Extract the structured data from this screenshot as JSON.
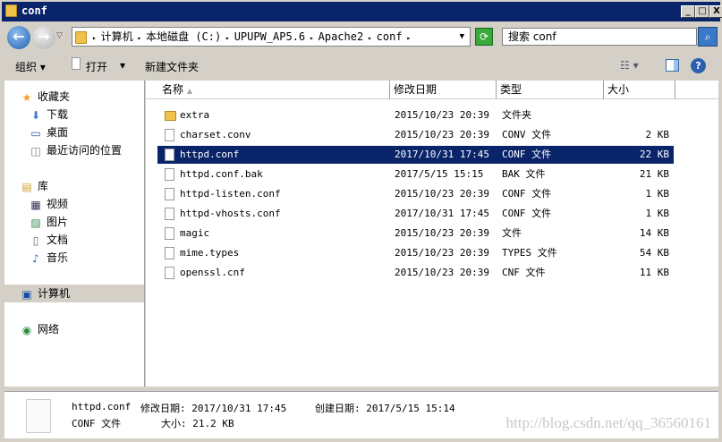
{
  "window": {
    "title": "conf",
    "buttons": [
      "_",
      "□",
      "X"
    ]
  },
  "address": {
    "path": [
      "计算机",
      "本地磁盘 (C:)",
      "UPUPW_AP5.6",
      "Apache2",
      "conf"
    ],
    "search_placeholder": "搜索 conf"
  },
  "toolbar": {
    "organize": "组织 ▾",
    "open": "打开",
    "open_arrow": "▾",
    "new_folder": "新建文件夹"
  },
  "sidebar": {
    "items": [
      {
        "label": "收藏夹",
        "icon": "star-icon",
        "level": 0
      },
      {
        "label": "下载",
        "icon": "downloads-icon",
        "level": 1
      },
      {
        "label": "桌面",
        "icon": "desktop-icon",
        "level": 1
      },
      {
        "label": "最近访问的位置",
        "icon": "recent-places-icon",
        "level": 1
      },
      {
        "label": "库",
        "icon": "library-icon",
        "level": 0
      },
      {
        "label": "视频",
        "icon": "video-icon",
        "level": 1
      },
      {
        "label": "图片",
        "icon": "pictures-icon",
        "level": 1
      },
      {
        "label": "文档",
        "icon": "documents-icon",
        "level": 1
      },
      {
        "label": "音乐",
        "icon": "music-icon",
        "level": 1
      },
      {
        "label": "计算机",
        "icon": "computer-icon",
        "level": 0,
        "selected": true
      },
      {
        "label": "网络",
        "icon": "network-icon",
        "level": 0
      }
    ]
  },
  "columns": {
    "name": "名称",
    "date": "修改日期",
    "type": "类型",
    "size": "大小"
  },
  "files": [
    {
      "name": "extra",
      "date": "2015/10/23 20:39",
      "type": "文件夹",
      "size": "",
      "dir": true
    },
    {
      "name": "charset.conv",
      "date": "2015/10/23 20:39",
      "type": "CONV 文件",
      "size": "2 KB"
    },
    {
      "name": "httpd.conf",
      "date": "2017/10/31 17:45",
      "type": "CONF 文件",
      "size": "22 KB",
      "selected": true
    },
    {
      "name": "httpd.conf.bak",
      "date": "2017/5/15 15:15",
      "type": "BAK 文件",
      "size": "21 KB"
    },
    {
      "name": "httpd-listen.conf",
      "date": "2015/10/23 20:39",
      "type": "CONF 文件",
      "size": "1 KB"
    },
    {
      "name": "httpd-vhosts.conf",
      "date": "2017/10/31 17:45",
      "type": "CONF 文件",
      "size": "1 KB"
    },
    {
      "name": "magic",
      "date": "2015/10/23 20:39",
      "type": "文件",
      "size": "14 KB"
    },
    {
      "name": "mime.types",
      "date": "2015/10/23 20:39",
      "type": "TYPES 文件",
      "size": "54 KB"
    },
    {
      "name": "openssl.cnf",
      "date": "2015/10/23 20:39",
      "type": "CNF 文件",
      "size": "11 KB"
    }
  ],
  "details": {
    "name": "httpd.conf",
    "modified": "修改日期: 2017/10/31 17:45",
    "created": "创建日期: 2017/5/15 15:14",
    "type": "CONF 文件",
    "size": "大小: 21.2 KB"
  },
  "watermark": "http://blog.csdn.net/qq_36560161"
}
